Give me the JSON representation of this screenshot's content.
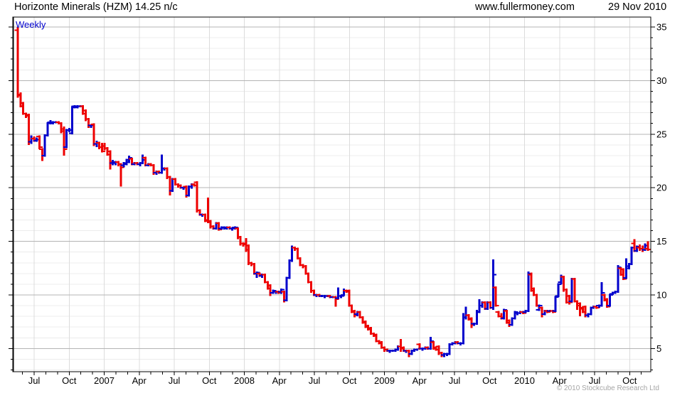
{
  "header": {
    "title": "Horizonte Minerals (HZM) 14.25 n/c",
    "website": "www.fullermoney.com",
    "date": "29 Nov 2010"
  },
  "chart": {
    "frequency_label": "Weekly",
    "copyright": "© 2010 Stockcube Research Ltd"
  },
  "chart_data": {
    "type": "ohlc-bar",
    "title": "Horizonte Minerals (HZM) weekly OHLC price",
    "frequency": "Weekly",
    "last_price": 14.25,
    "x_labels": [
      "Jul",
      "Oct",
      "2007",
      "Apr",
      "Jul",
      "Oct",
      "2008",
      "Apr",
      "Jul",
      "Oct",
      "2009",
      "Apr",
      "Jul",
      "Oct",
      "2010",
      "Apr",
      "Jul",
      "Oct"
    ],
    "x_range": [
      "Jun 2006",
      "29 Nov 2010"
    ],
    "y_ticks": [
      35,
      30,
      25,
      20,
      15,
      10,
      5
    ],
    "ylim": [
      2.8,
      36
    ],
    "grid": true,
    "axis_side": "right",
    "up_color": "#0000cc",
    "down_color": "#ee0000",
    "grid_minor_color": "#ececec",
    "grid_major_color": "#b4b4b4",
    "grid_vert_color": "#dcdcdc",
    "bars": [
      [
        34.7,
        35.0,
        28.4,
        28.6
      ],
      [
        28.7,
        28.9,
        27.5,
        27.6
      ],
      [
        27.9,
        28.0,
        26.8,
        26.9
      ],
      [
        26.9,
        27.0,
        26.5,
        26.7
      ],
      [
        26.8,
        26.9,
        24.0,
        24.3
      ],
      [
        24.3,
        24.9,
        24.1,
        24.6
      ],
      [
        24.6,
        24.8,
        24.3,
        24.5
      ],
      [
        24.4,
        24.7,
        24.3,
        24.5
      ],
      [
        24.8,
        24.9,
        23.6,
        23.8
      ],
      [
        23.6,
        23.7,
        22.5,
        23.0
      ],
      [
        23.0,
        25.0,
        22.9,
        24.9
      ],
      [
        24.9,
        26.1,
        24.8,
        26.0
      ],
      [
        26.1,
        26.3,
        25.9,
        26.1
      ],
      [
        26.0,
        26.2,
        25.9,
        26.1
      ],
      [
        26.1,
        26.2,
        26.0,
        26.1
      ],
      [
        26.1,
        26.2,
        25.9,
        26.0
      ],
      [
        26.0,
        26.1,
        25.1,
        25.3
      ],
      [
        25.5,
        25.7,
        23.0,
        23.6
      ],
      [
        23.8,
        25.5,
        23.7,
        25.4
      ],
      [
        25.4,
        25.6,
        25.2,
        25.4
      ],
      [
        25.1,
        27.6,
        25.0,
        27.5
      ],
      [
        27.6,
        27.7,
        27.4,
        27.6
      ],
      [
        27.5,
        27.7,
        27.4,
        27.6
      ],
      [
        27.6,
        27.7,
        27.5,
        27.6
      ],
      [
        27.6,
        27.7,
        26.8,
        26.9
      ],
      [
        27.2,
        27.3,
        26.2,
        26.4
      ],
      [
        26.4,
        26.5,
        25.6,
        25.8
      ],
      [
        25.8,
        25.9,
        25.6,
        25.8
      ],
      [
        25.9,
        26.0,
        23.9,
        24.1
      ],
      [
        24.1,
        24.4,
        23.8,
        24.2
      ],
      [
        24.2,
        24.3,
        23.6,
        23.8
      ],
      [
        23.8,
        24.2,
        23.3,
        23.4
      ],
      [
        23.9,
        24.2,
        23.5,
        23.7
      ],
      [
        23.7,
        23.8,
        23.0,
        23.1
      ],
      [
        23.4,
        23.5,
        21.7,
        22.4
      ],
      [
        22.3,
        22.6,
        22.1,
        22.4
      ],
      [
        22.3,
        22.5,
        22.1,
        22.4
      ],
      [
        22.4,
        22.5,
        22.0,
        22.2
      ],
      [
        22.2,
        22.3,
        20.1,
        21.9
      ],
      [
        22.1,
        22.4,
        21.9,
        22.3
      ],
      [
        22.2,
        22.7,
        22.1,
        22.6
      ],
      [
        22.4,
        23.0,
        22.3,
        22.8
      ],
      [
        22.7,
        22.8,
        22.1,
        22.2
      ],
      [
        22.2,
        22.4,
        22.1,
        22.3
      ],
      [
        22.3,
        22.4,
        22.1,
        22.2
      ],
      [
        22.2,
        22.4,
        22.0,
        22.3
      ],
      [
        22.3,
        23.1,
        22.2,
        22.6
      ],
      [
        22.8,
        22.9,
        22.0,
        22.1
      ],
      [
        22.1,
        22.3,
        22.0,
        22.2
      ],
      [
        22.2,
        22.3,
        22.0,
        22.1
      ],
      [
        22.1,
        22.2,
        21.2,
        21.4
      ],
      [
        21.4,
        21.6,
        21.2,
        21.5
      ],
      [
        21.5,
        21.6,
        21.3,
        21.4
      ],
      [
        21.4,
        23.1,
        21.3,
        21.8
      ],
      [
        21.8,
        21.9,
        21.6,
        21.8
      ],
      [
        21.8,
        21.9,
        20.8,
        21.0
      ],
      [
        21.0,
        21.1,
        19.3,
        19.7
      ],
      [
        19.7,
        20.9,
        19.6,
        20.8
      ],
      [
        20.8,
        20.9,
        20.2,
        20.3
      ],
      [
        20.3,
        20.4,
        20.0,
        20.2
      ],
      [
        20.2,
        20.3,
        19.9,
        20.0
      ],
      [
        20.0,
        20.1,
        19.8,
        20.0
      ],
      [
        20.1,
        20.2,
        19.1,
        19.3
      ],
      [
        19.3,
        20.2,
        19.2,
        20.1
      ],
      [
        20.1,
        20.4,
        19.9,
        20.3
      ],
      [
        20.3,
        20.4,
        20.1,
        20.2
      ],
      [
        20.5,
        20.6,
        17.7,
        17.9
      ],
      [
        17.9,
        18.0,
        17.4,
        17.5
      ],
      [
        17.5,
        17.6,
        17.3,
        17.5
      ],
      [
        17.5,
        17.6,
        16.8,
        16.9
      ],
      [
        17.0,
        19.1,
        16.7,
        16.8
      ],
      [
        16.9,
        17.0,
        16.2,
        16.4
      ],
      [
        16.4,
        16.5,
        16.1,
        16.2
      ],
      [
        16.2,
        16.8,
        16.1,
        16.7
      ],
      [
        16.7,
        16.8,
        16.0,
        16.1
      ],
      [
        16.2,
        16.4,
        16.1,
        16.3
      ],
      [
        16.3,
        16.4,
        16.1,
        16.3
      ],
      [
        16.2,
        16.4,
        16.1,
        16.3
      ],
      [
        16.3,
        16.4,
        16.1,
        16.2
      ],
      [
        16.2,
        16.3,
        16.0,
        16.2
      ],
      [
        16.3,
        16.4,
        16.1,
        16.3
      ],
      [
        16.2,
        16.3,
        15.2,
        15.4
      ],
      [
        15.4,
        15.5,
        14.6,
        14.8
      ],
      [
        14.8,
        14.9,
        14.5,
        14.7
      ],
      [
        14.8,
        15.3,
        14.0,
        14.2
      ],
      [
        14.6,
        14.7,
        12.8,
        13.0
      ],
      [
        13.0,
        13.1,
        12.7,
        12.9
      ],
      [
        12.9,
        13.0,
        11.9,
        12.0
      ],
      [
        12.0,
        12.2,
        11.6,
        12.1
      ],
      [
        12.0,
        12.1,
        11.7,
        11.9
      ],
      [
        11.8,
        12.0,
        11.6,
        11.9
      ],
      [
        11.9,
        12.0,
        11.1,
        11.2
      ],
      [
        11.2,
        11.3,
        10.5,
        10.6
      ],
      [
        10.9,
        11.0,
        9.9,
        10.2
      ],
      [
        10.2,
        10.5,
        10.1,
        10.4
      ],
      [
        10.3,
        10.4,
        10.1,
        10.3
      ],
      [
        10.3,
        10.4,
        10.1,
        10.2
      ],
      [
        10.3,
        10.6,
        10.1,
        10.5
      ],
      [
        10.3,
        10.4,
        9.3,
        9.5
      ],
      [
        9.5,
        11.7,
        9.4,
        11.6
      ],
      [
        11.6,
        13.3,
        11.5,
        13.2
      ],
      [
        13.2,
        14.6,
        13.1,
        14.4
      ],
      [
        14.4,
        14.5,
        14.1,
        14.3
      ],
      [
        14.3,
        14.4,
        13.3,
        13.4
      ],
      [
        13.4,
        13.5,
        12.7,
        12.8
      ],
      [
        12.8,
        12.9,
        12.5,
        12.7
      ],
      [
        12.7,
        12.8,
        11.9,
        12.0
      ],
      [
        12.0,
        12.1,
        11.1,
        11.2
      ],
      [
        11.2,
        11.3,
        10.2,
        10.4
      ],
      [
        10.4,
        10.5,
        9.9,
        10.0
      ],
      [
        10.0,
        10.1,
        9.8,
        10.0
      ],
      [
        10.0,
        10.1,
        9.8,
        9.9
      ],
      [
        9.9,
        10.0,
        9.8,
        9.9
      ],
      [
        9.9,
        10.0,
        9.7,
        9.9
      ],
      [
        9.9,
        10.0,
        9.8,
        9.9
      ],
      [
        9.9,
        10.0,
        9.7,
        9.8
      ],
      [
        9.8,
        9.9,
        9.7,
        9.8
      ],
      [
        9.8,
        9.9,
        8.9,
        9.6
      ],
      [
        9.7,
        10.7,
        9.6,
        9.9
      ],
      [
        9.9,
        10.0,
        9.7,
        9.9
      ],
      [
        10.0,
        10.6,
        9.9,
        10.4
      ],
      [
        10.4,
        10.5,
        10.2,
        10.3
      ],
      [
        10.4,
        10.5,
        8.9,
        9.0
      ],
      [
        9.0,
        9.1,
        8.3,
        8.4
      ],
      [
        8.5,
        8.6,
        7.9,
        8.1
      ],
      [
        8.2,
        8.5,
        8.0,
        8.4
      ],
      [
        8.4,
        8.5,
        7.8,
        7.9
      ],
      [
        7.9,
        8.0,
        7.3,
        7.4
      ],
      [
        7.5,
        7.6,
        6.9,
        7.0
      ],
      [
        7.1,
        7.2,
        6.7,
        6.8
      ],
      [
        6.9,
        7.0,
        6.3,
        6.4
      ],
      [
        6.4,
        6.5,
        6.1,
        6.2
      ],
      [
        6.3,
        6.4,
        5.6,
        5.7
      ],
      [
        5.7,
        5.8,
        5.4,
        5.5
      ],
      [
        5.6,
        5.7,
        5.0,
        5.1
      ],
      [
        5.1,
        5.2,
        4.7,
        4.9
      ],
      [
        4.9,
        5.0,
        4.7,
        4.8
      ],
      [
        4.8,
        4.9,
        4.6,
        4.8
      ],
      [
        4.8,
        4.9,
        4.7,
        4.8
      ],
      [
        4.8,
        5.0,
        4.7,
        4.9
      ],
      [
        4.9,
        5.3,
        4.8,
        5.2
      ],
      [
        5.2,
        5.9,
        4.7,
        5.0
      ],
      [
        5.1,
        5.2,
        4.7,
        4.8
      ],
      [
        4.8,
        4.9,
        4.6,
        4.8
      ],
      [
        4.8,
        4.9,
        4.2,
        4.5
      ],
      [
        4.5,
        4.9,
        4.4,
        4.8
      ],
      [
        4.8,
        5.0,
        4.7,
        4.9
      ],
      [
        4.9,
        5.0,
        4.8,
        5.0
      ],
      [
        5.4,
        5.5,
        4.9,
        5.0
      ],
      [
        5.0,
        5.1,
        4.8,
        5.0
      ],
      [
        5.0,
        5.2,
        4.9,
        5.1
      ],
      [
        5.1,
        5.2,
        4.9,
        5.0
      ],
      [
        5.0,
        6.1,
        4.9,
        5.7
      ],
      [
        5.6,
        5.7,
        4.9,
        5.0
      ],
      [
        5.1,
        5.2,
        4.8,
        4.9
      ],
      [
        5.2,
        5.3,
        4.4,
        4.6
      ],
      [
        4.6,
        4.7,
        4.2,
        4.4
      ],
      [
        4.4,
        4.6,
        4.2,
        4.5
      ],
      [
        4.5,
        4.6,
        4.3,
        4.5
      ],
      [
        4.5,
        5.5,
        4.4,
        5.4
      ],
      [
        5.4,
        5.6,
        5.3,
        5.5
      ],
      [
        5.5,
        5.7,
        5.4,
        5.6
      ],
      [
        5.6,
        5.7,
        5.4,
        5.5
      ],
      [
        5.5,
        5.6,
        5.3,
        5.5
      ],
      [
        5.5,
        8.3,
        5.4,
        7.9
      ],
      [
        7.9,
        8.9,
        7.7,
        8.1
      ],
      [
        8.1,
        8.2,
        7.6,
        7.7
      ],
      [
        7.8,
        7.9,
        6.9,
        7.2
      ],
      [
        7.3,
        7.4,
        7.1,
        7.3
      ],
      [
        7.3,
        8.6,
        7.2,
        8.4
      ],
      [
        8.4,
        9.6,
        8.3,
        9.0
      ],
      [
        9.0,
        9.4,
        8.8,
        9.3
      ],
      [
        9.3,
        9.4,
        8.6,
        8.7
      ],
      [
        8.7,
        9.4,
        8.6,
        9.3
      ],
      [
        9.3,
        9.4,
        8.7,
        8.8
      ],
      [
        8.8,
        13.3,
        8.6,
        11.9
      ],
      [
        10.7,
        10.8,
        8.9,
        9.0
      ],
      [
        8.4,
        8.5,
        7.9,
        8.0
      ],
      [
        8.0,
        8.3,
        7.7,
        7.9
      ],
      [
        7.8,
        8.7,
        7.7,
        8.6
      ],
      [
        8.5,
        8.6,
        7.3,
        7.4
      ],
      [
        7.6,
        7.7,
        7.0,
        7.2
      ],
      [
        7.2,
        7.9,
        7.1,
        7.8
      ],
      [
        7.8,
        8.5,
        7.7,
        8.4
      ],
      [
        8.3,
        8.4,
        8.1,
        8.3
      ],
      [
        8.3,
        8.5,
        8.2,
        8.4
      ],
      [
        8.4,
        8.5,
        8.2,
        8.3
      ],
      [
        8.4,
        8.6,
        8.3,
        8.5
      ],
      [
        8.5,
        12.2,
        8.4,
        12.0
      ],
      [
        11.9,
        12.1,
        10.3,
        10.4
      ],
      [
        10.6,
        10.7,
        9.9,
        10.0
      ],
      [
        10.0,
        10.1,
        8.9,
        9.0
      ],
      [
        8.6,
        9.1,
        8.5,
        9.0
      ],
      [
        8.8,
        8.9,
        7.9,
        8.2
      ],
      [
        8.2,
        8.6,
        8.1,
        8.5
      ],
      [
        8.5,
        8.6,
        8.3,
        8.4
      ],
      [
        8.5,
        8.6,
        8.4,
        8.5
      ],
      [
        8.5,
        8.6,
        8.3,
        8.4
      ],
      [
        8.5,
        9.9,
        8.4,
        9.8
      ],
      [
        9.9,
        11.1,
        9.8,
        11.0
      ],
      [
        11.2,
        11.9,
        11.0,
        11.7
      ],
      [
        11.7,
        11.8,
        10.3,
        10.5
      ],
      [
        10.5,
        10.6,
        9.2,
        9.3
      ],
      [
        9.9,
        10.0,
        9.1,
        9.3
      ],
      [
        9.4,
        11.6,
        9.3,
        11.5
      ],
      [
        11.5,
        11.6,
        9.3,
        9.4
      ],
      [
        9.4,
        9.5,
        8.6,
        9.0
      ],
      [
        9.2,
        9.3,
        8.0,
        8.7
      ],
      [
        8.8,
        8.9,
        8.3,
        8.4
      ],
      [
        8.9,
        9.0,
        7.9,
        8.1
      ],
      [
        8.1,
        8.3,
        7.9,
        8.2
      ],
      [
        8.2,
        8.9,
        8.1,
        8.8
      ],
      [
        8.8,
        9.0,
        8.7,
        8.9
      ],
      [
        8.9,
        9.0,
        8.7,
        8.8
      ],
      [
        9.0,
        9.1,
        8.8,
        9.0
      ],
      [
        9.0,
        11.2,
        8.9,
        10.2
      ],
      [
        10.0,
        10.1,
        9.4,
        9.5
      ],
      [
        9.6,
        9.7,
        8.8,
        8.9
      ],
      [
        9.0,
        10.1,
        8.9,
        10.0
      ],
      [
        10.1,
        10.3,
        10.0,
        10.2
      ],
      [
        10.2,
        10.4,
        10.1,
        10.3
      ],
      [
        10.3,
        12.8,
        10.2,
        12.6
      ],
      [
        12.5,
        12.6,
        11.8,
        11.9
      ],
      [
        12.4,
        12.5,
        11.4,
        11.5
      ],
      [
        11.6,
        13.4,
        11.5,
        12.7
      ],
      [
        12.5,
        13.0,
        12.4,
        12.9
      ],
      [
        12.9,
        14.5,
        12.8,
        14.4
      ],
      [
        14.8,
        15.2,
        14.0,
        14.1
      ],
      [
        14.1,
        14.6,
        14.0,
        14.5
      ],
      [
        14.4,
        14.7,
        14.1,
        14.3
      ],
      [
        14.3,
        14.6,
        14.0,
        14.2
      ],
      [
        14.2,
        14.8,
        14.1,
        14.6
      ],
      [
        14.3,
        15.0,
        14.1,
        14.25
      ]
    ]
  }
}
